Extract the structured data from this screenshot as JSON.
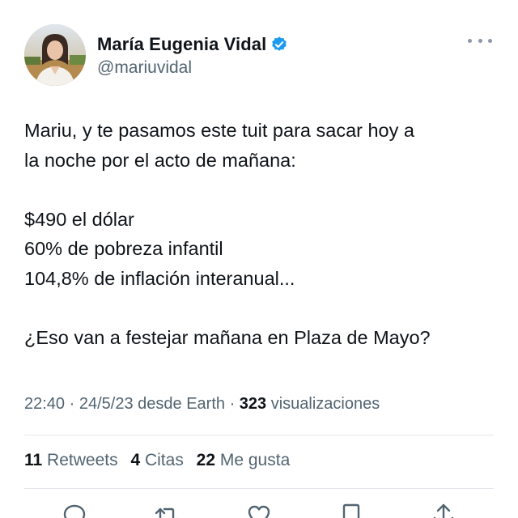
{
  "author": {
    "name": "María Eugenia Vidal",
    "handle": "@mariuvidal",
    "verified": true,
    "verified_color": "#1d9bf0"
  },
  "tweet": {
    "lines": [
      "Mariu, y te pasamos este tuit para sacar hoy a",
      "la noche por el acto de mañana:",
      "$490 el dólar",
      "60% de pobreza infantil",
      "104,8% de inflación interanual...",
      "¿Eso van a festejar mañana en Plaza de Mayo?"
    ]
  },
  "meta": {
    "time": "22:40",
    "date": "24/5/23",
    "source": "desde Earth",
    "views_count": "323",
    "views_label": "visualizaciones"
  },
  "stats": {
    "retweets_count": "11",
    "retweets_label": "Retweets",
    "quotes_count": "4",
    "quotes_label": "Citas",
    "likes_count": "22",
    "likes_label": "Me gusta"
  },
  "actions": {
    "icons": [
      "reply-icon",
      "retweet-icon",
      "like-icon",
      "bookmark-icon",
      "share-icon"
    ]
  },
  "colors": {
    "text": "#0f1419",
    "secondary": "#536471",
    "divider": "#e1e6ea"
  }
}
